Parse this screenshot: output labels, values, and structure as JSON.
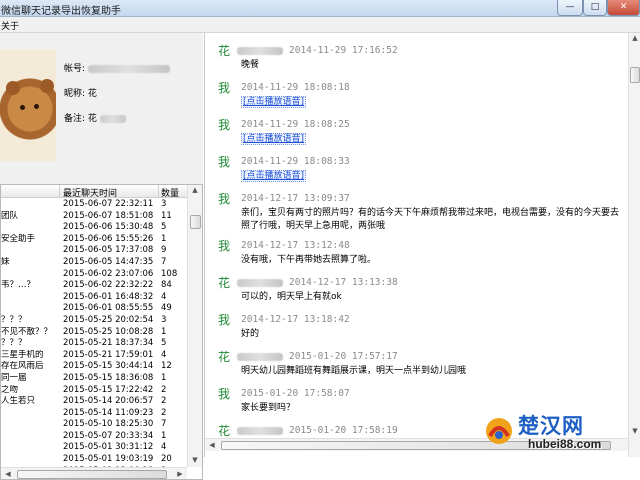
{
  "window": {
    "title": "微信聊天记录导出恢复助手",
    "min_label": "—",
    "max_label": "□",
    "close_label": "✕"
  },
  "menu": {
    "about": "关于"
  },
  "profile": {
    "account_label": "帐号:",
    "nickname_label": "昵称:",
    "nickname_value": "花",
    "note_label": "备注:",
    "note_value": "花"
  },
  "contacts": {
    "headers": {
      "time": "最近聊天时间",
      "count": "数量"
    },
    "rows": [
      {
        "name": "",
        "time": "2015-06-07 22:32:11",
        "count": "3"
      },
      {
        "name": "团队",
        "time": "2015-06-07 18:51:08",
        "count": "11"
      },
      {
        "name": "",
        "time": "2015-06-06 15:30:48",
        "count": "5"
      },
      {
        "name": "安全助手",
        "time": "2015-06-06 15:55:26",
        "count": "1"
      },
      {
        "name": "",
        "time": "2015-06-05 17:37:08",
        "count": "9"
      },
      {
        "name": "妹",
        "time": "2015-06-05 14:47:35",
        "count": "7"
      },
      {
        "name": "",
        "time": "2015-06-02 23:07:06",
        "count": "108"
      },
      {
        "name": "韦？…？",
        "time": "2015-06-02 22:32:22",
        "count": "84"
      },
      {
        "name": "",
        "time": "2015-06-01 16:48:32",
        "count": "4"
      },
      {
        "name": "",
        "time": "2015-06-01 08:55:55",
        "count": "49"
      },
      {
        "name": "？？？",
        "time": "2015-05-25 20:02:54",
        "count": "3"
      },
      {
        "name": "不见不散？？",
        "time": "2015-05-25 10:08:28",
        "count": "1"
      },
      {
        "name": "？？？",
        "time": "2015-05-21 18:37:34",
        "count": "5"
      },
      {
        "name": "三星手机的",
        "time": "2015-05-21 17:59:01",
        "count": "4"
      },
      {
        "name": "存在风雨后",
        "time": "2015-05-15 30:44:14",
        "count": "12"
      },
      {
        "name": "同一届",
        "time": "2015-05-15 18:36:08",
        "count": "1"
      },
      {
        "name": "之吻",
        "time": "2015-05-15 17:22:42",
        "count": "2"
      },
      {
        "name": "人生若只",
        "time": "2015-05-14 20:06:57",
        "count": "2"
      },
      {
        "name": "",
        "time": "2015-05-14 11:09:23",
        "count": "2"
      },
      {
        "name": "",
        "time": "2015-05-10 18:25:30",
        "count": "7"
      },
      {
        "name": "",
        "time": "2015-05-07 20:33:34",
        "count": "1"
      },
      {
        "name": "",
        "time": "2015-05-01 30:31:12",
        "count": "4"
      },
      {
        "name": "",
        "time": "2015-05-01 19:03:19",
        "count": "20"
      },
      {
        "name": "",
        "time": "2015-05-01 13:00:18",
        "count": "2"
      }
    ]
  },
  "messages": [
    {
      "sender": "花",
      "time": "2014-11-29 17:16:52",
      "text": "晚餐",
      "voice": false
    },
    {
      "sender": "我",
      "time": "2014-11-29 18:08:18",
      "text": "[点击播放语音]",
      "voice": true
    },
    {
      "sender": "我",
      "time": "2014-11-29 18:08:25",
      "text": "[点击播放语音]",
      "voice": true
    },
    {
      "sender": "我",
      "time": "2014-11-29 18:08:33",
      "text": "[点击播放语音]",
      "voice": true
    },
    {
      "sender": "我",
      "time": "2014-12-17 13:09:37",
      "text": "亲们，宝贝有两寸的照片吗？有的话今天下午麻烦帮我带过来吧，电视台需要，没有的今天要去照了行哦，明天早上急用呢，两张哦",
      "voice": false
    },
    {
      "sender": "我",
      "time": "2014-12-17 13:12:48",
      "text": "没有哦，下午再带她去照算了啦。",
      "voice": false
    },
    {
      "sender": "花",
      "time": "2014-12-17 13:13:38",
      "text": "可以的，明天早上有就ok",
      "voice": false
    },
    {
      "sender": "我",
      "time": "2014-12-17 13:18:42",
      "text": "好的",
      "voice": false
    },
    {
      "sender": "花",
      "time": "2015-01-20 17:57:17",
      "text": "明天幼儿园舞蹈班有舞蹈展示课，明天一点半到幼儿园哦",
      "voice": false
    },
    {
      "sender": "我",
      "time": "2015-01-20 17:58:07",
      "text": "家长要到吗？",
      "voice": false
    },
    {
      "sender": "花",
      "time": "2015-01-20 17:58:19",
      "text": "",
      "voice": false
    }
  ],
  "watermark": {
    "text": "楚汉网",
    "url": "hubei88.com"
  }
}
